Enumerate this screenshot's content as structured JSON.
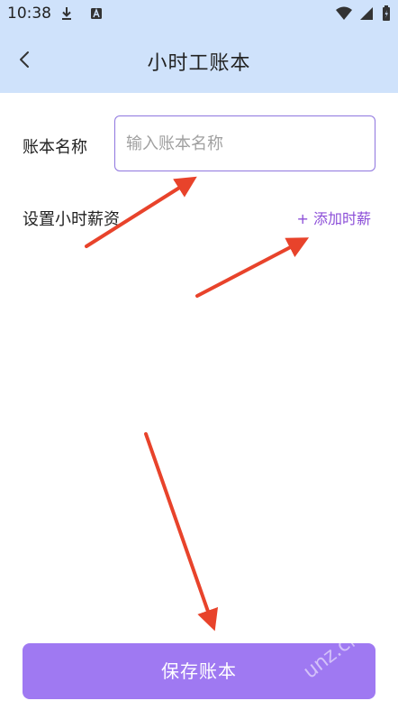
{
  "status_bar": {
    "time": "10:38",
    "icons_left": [
      "download-icon",
      "a-badge-icon"
    ],
    "icons_right": [
      "wifi-icon",
      "signal-icon",
      "battery-icon"
    ]
  },
  "nav": {
    "back_icon": "chevron-left-icon",
    "title": "小时工账本"
  },
  "form": {
    "name_label": "账本名称",
    "name_placeholder": "输入账本名称",
    "name_value": "",
    "wage_label": "设置小时薪资",
    "add_wage_label": "+ 添加时薪"
  },
  "footer": {
    "save_label": "保存账本"
  },
  "colors": {
    "header_bg": "#cfe2fb",
    "accent": "#9f79f2",
    "link": "#8c4fd8",
    "annotation_arrow": "#e8432b"
  }
}
